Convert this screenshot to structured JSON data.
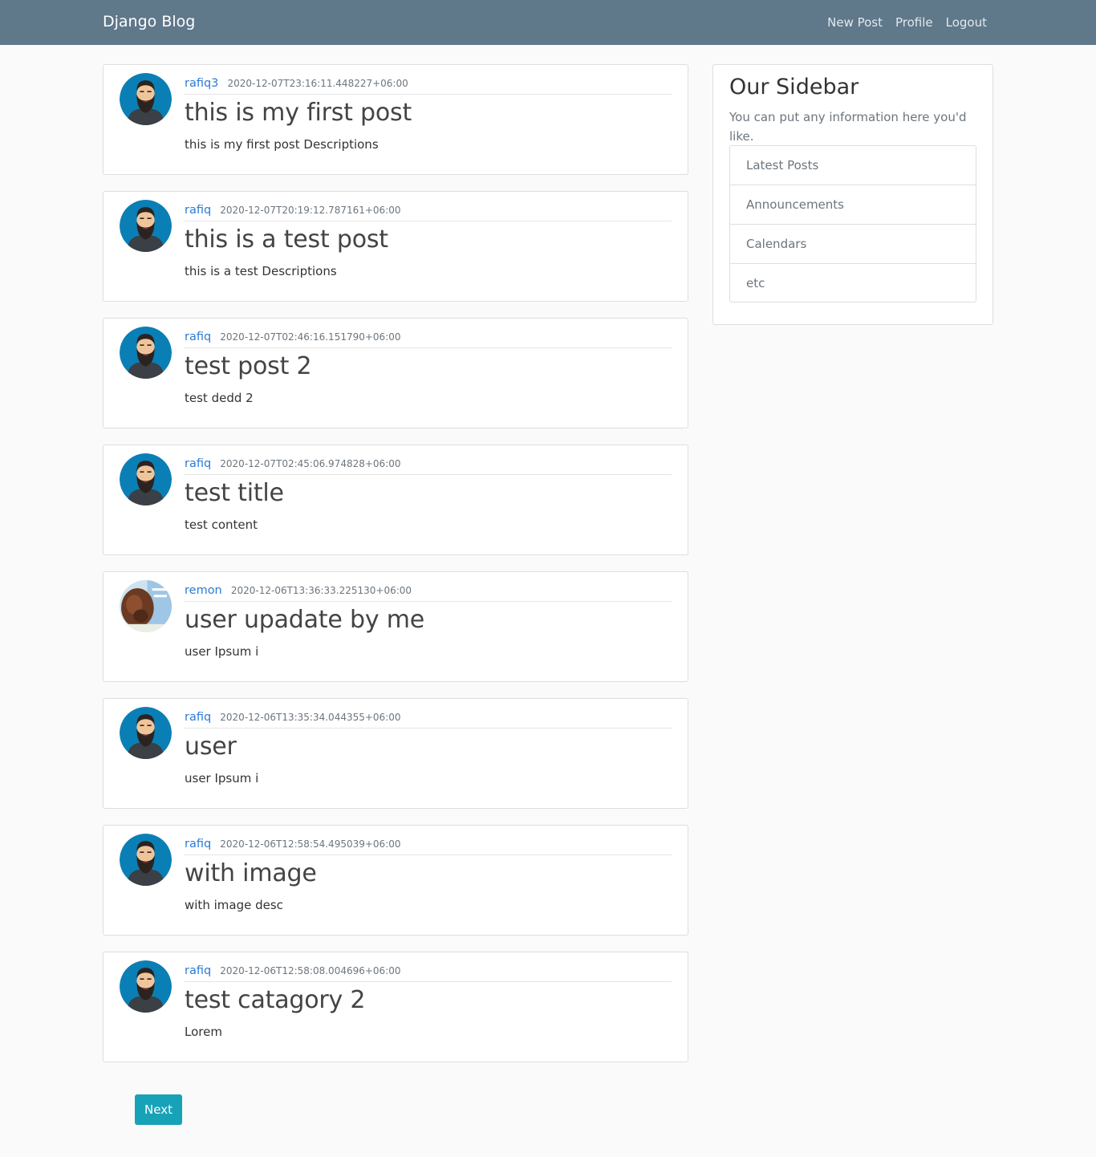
{
  "navbar": {
    "brand": "Django Blog",
    "links": [
      "New Post",
      "Profile",
      "Logout"
    ]
  },
  "posts": [
    {
      "author": "rafiq3",
      "date": "2020-12-07T23:16:11.448227+06:00",
      "title": "this is my first post",
      "desc": "this is my first post Descriptions",
      "avatar": "bearded-man-icon"
    },
    {
      "author": "rafiq",
      "date": "2020-12-07T20:19:12.787161+06:00",
      "title": "this is a test post",
      "desc": "this is a test Descriptions",
      "avatar": "bearded-man-icon"
    },
    {
      "author": "rafiq",
      "date": "2020-12-07T02:46:16.151790+06:00",
      "title": "test post 2",
      "desc": "test dedd 2",
      "avatar": "bearded-man-icon"
    },
    {
      "author": "rafiq",
      "date": "2020-12-07T02:45:06.974828+06:00",
      "title": "test title",
      "desc": "test content",
      "avatar": "bearded-man-icon"
    },
    {
      "author": "remon",
      "date": "2020-12-06T13:36:33.225130+06:00",
      "title": "user upadate by me",
      "desc": "user Ipsum i",
      "avatar": "photo-avatar-icon"
    },
    {
      "author": "rafiq",
      "date": "2020-12-06T13:35:34.044355+06:00",
      "title": "user",
      "desc": "user Ipsum i",
      "avatar": "bearded-man-icon"
    },
    {
      "author": "rafiq",
      "date": "2020-12-06T12:58:54.495039+06:00",
      "title": "with image",
      "desc": "with image desc",
      "avatar": "bearded-man-icon"
    },
    {
      "author": "rafiq",
      "date": "2020-12-06T12:58:08.004696+06:00",
      "title": "test catagory 2",
      "desc": "Lorem",
      "avatar": "bearded-man-icon"
    }
  ],
  "sidebar": {
    "title": "Our Sidebar",
    "text": "You can put any information here you'd like.",
    "items": [
      "Latest Posts",
      "Announcements",
      "Calendars",
      "etc"
    ]
  },
  "pagination": {
    "next_label": "Next"
  },
  "colors": {
    "navbar": "#5f788a",
    "link": "#2a7bd3",
    "button": "#17a2b8",
    "avatar_bg": "#0a7fb5"
  }
}
